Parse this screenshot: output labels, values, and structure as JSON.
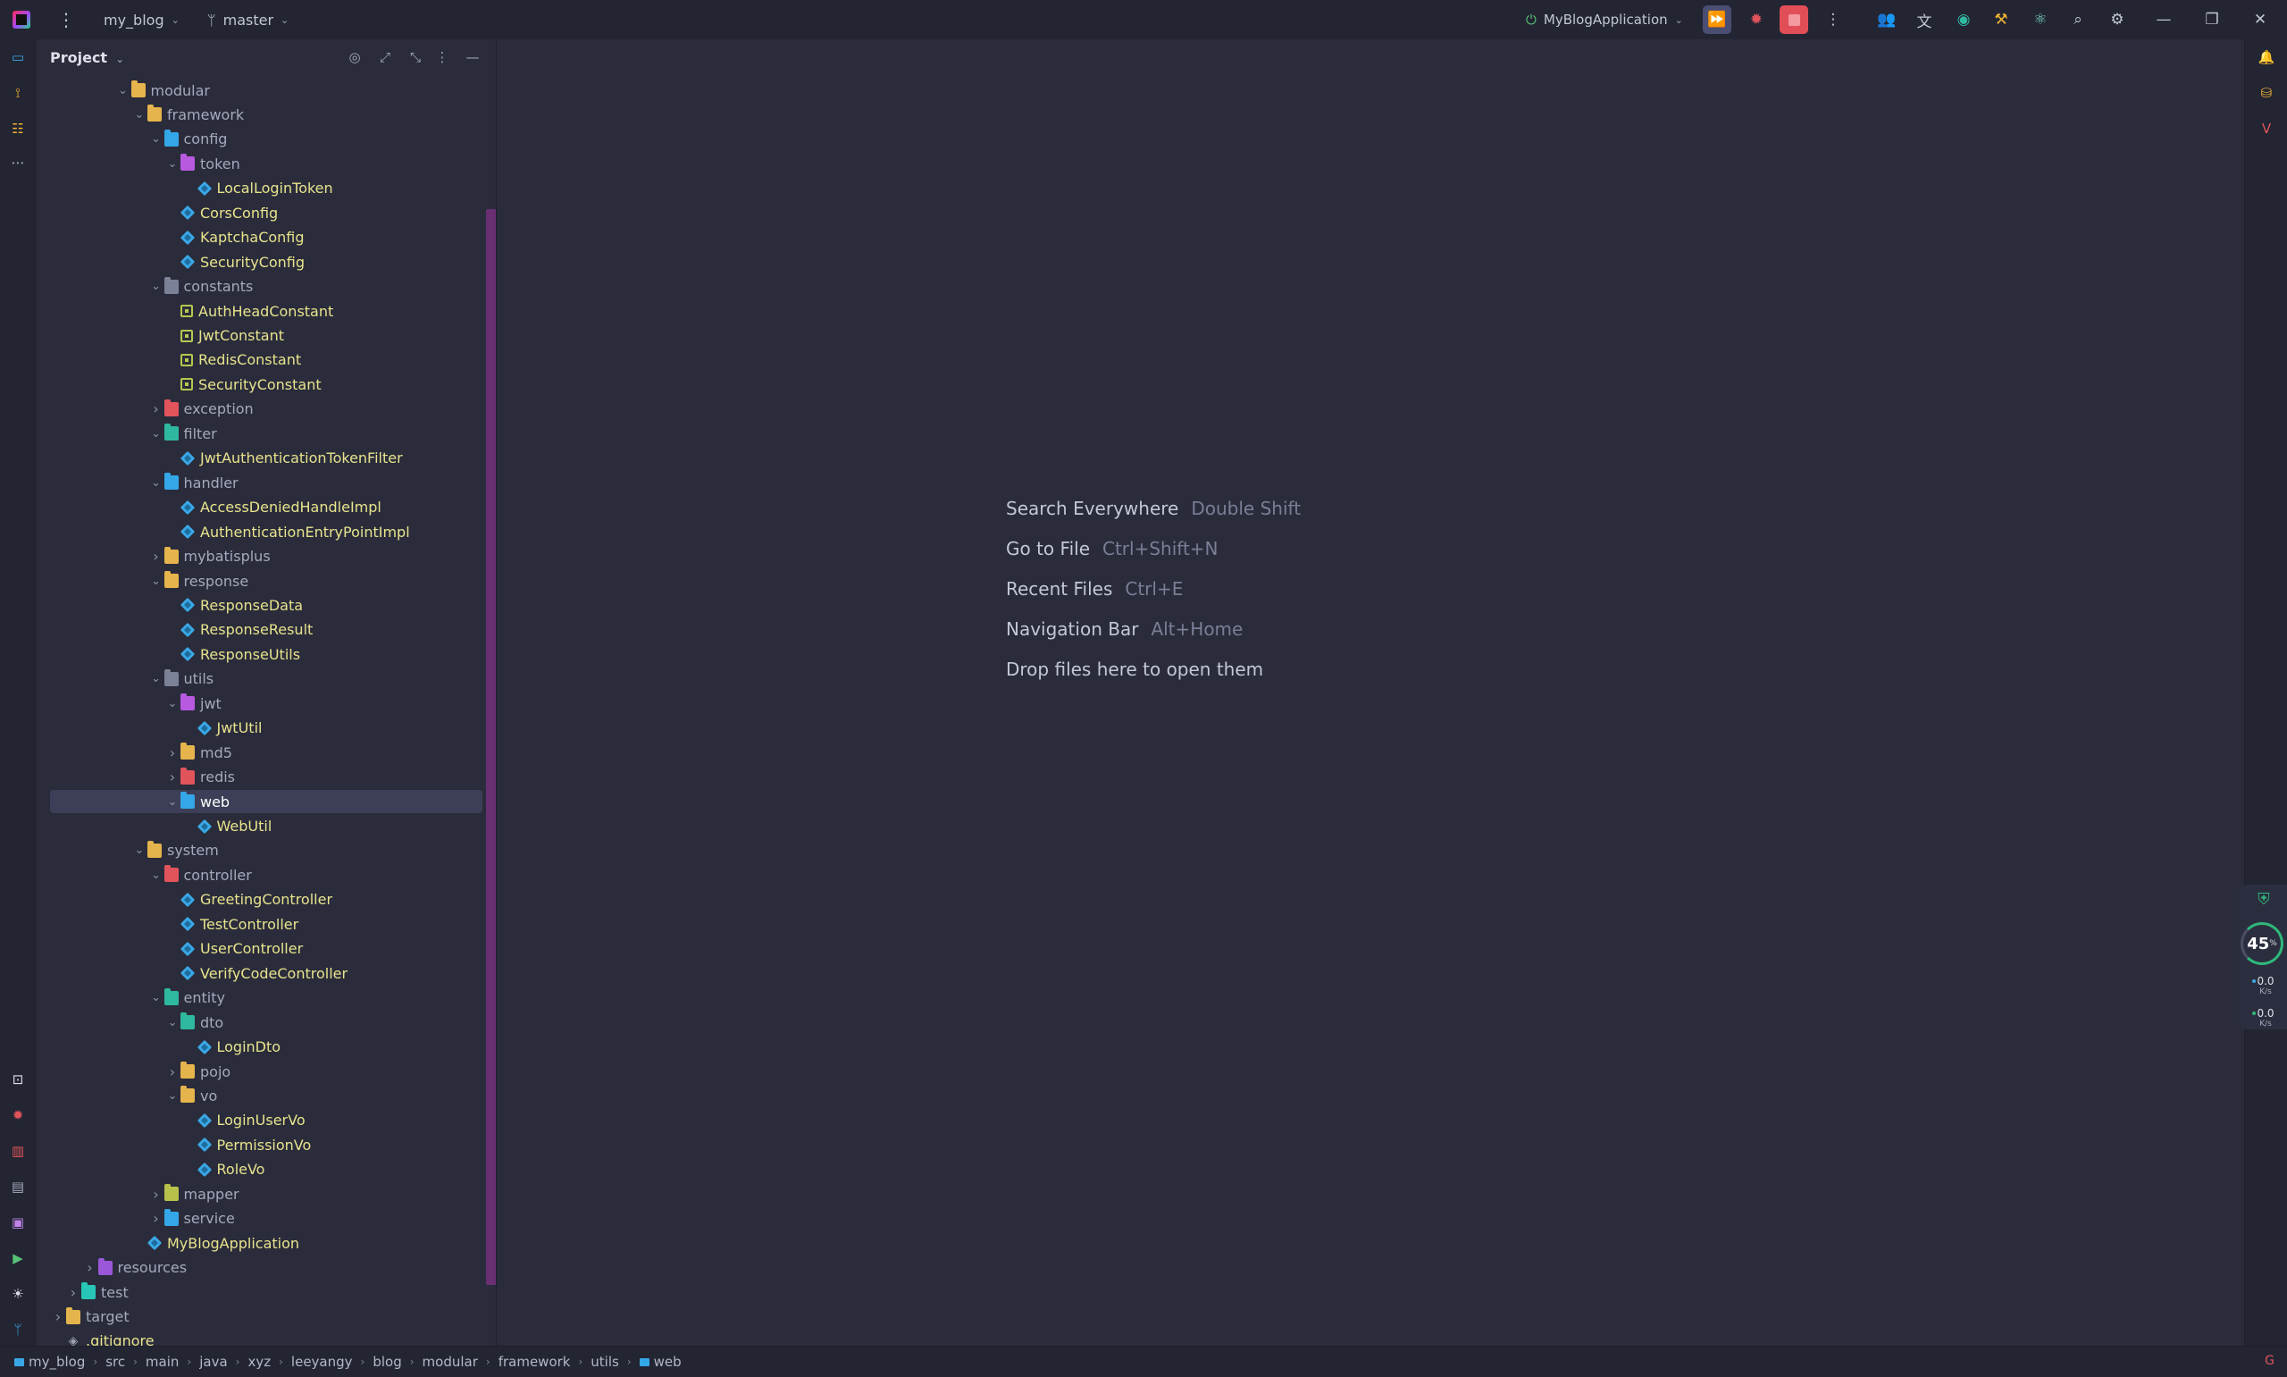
{
  "titlebar": {
    "project": "my_blog",
    "branch": "master",
    "run_config": "MyBlogApplication"
  },
  "panel": {
    "title": "Project"
  },
  "tree": [
    {
      "label": "modular",
      "type": "folder",
      "depth": 5,
      "expanded": true,
      "color": "pkg-default"
    },
    {
      "label": "framework",
      "type": "folder",
      "depth": 6,
      "expanded": true,
      "color": "pkg-default"
    },
    {
      "label": "config",
      "type": "folder",
      "depth": 7,
      "expanded": true,
      "color": "pkg-blue"
    },
    {
      "label": "token",
      "type": "folder",
      "depth": 8,
      "expanded": true,
      "color": "pkg-purple"
    },
    {
      "label": "LocalLoginToken",
      "type": "class",
      "depth": 9
    },
    {
      "label": "CorsConfig",
      "type": "class",
      "depth": 8
    },
    {
      "label": "KaptchaConfig",
      "type": "class",
      "depth": 8
    },
    {
      "label": "SecurityConfig",
      "type": "class",
      "depth": 8
    },
    {
      "label": "constants",
      "type": "folder",
      "depth": 7,
      "expanded": true,
      "color": "pkg-gray"
    },
    {
      "label": "AuthHeadConstant",
      "type": "const",
      "depth": 8
    },
    {
      "label": "JwtConstant",
      "type": "const",
      "depth": 8
    },
    {
      "label": "RedisConstant",
      "type": "const",
      "depth": 8
    },
    {
      "label": "SecurityConstant",
      "type": "const",
      "depth": 8
    },
    {
      "label": "exception",
      "type": "folder",
      "depth": 7,
      "expanded": false,
      "color": "pkg-red"
    },
    {
      "label": "filter",
      "type": "folder",
      "depth": 7,
      "expanded": true,
      "color": "pkg-green"
    },
    {
      "label": "JwtAuthenticationTokenFilter",
      "type": "class",
      "depth": 8
    },
    {
      "label": "handler",
      "type": "folder",
      "depth": 7,
      "expanded": true,
      "color": "pkg-blue"
    },
    {
      "label": "AccessDeniedHandleImpl",
      "type": "class",
      "depth": 8
    },
    {
      "label": "AuthenticationEntryPointImpl",
      "type": "class",
      "depth": 8
    },
    {
      "label": "mybatisplus",
      "type": "folder",
      "depth": 7,
      "expanded": false,
      "color": "pkg-default"
    },
    {
      "label": "response",
      "type": "folder",
      "depth": 7,
      "expanded": true,
      "color": "pkg-default"
    },
    {
      "label": "ResponseData",
      "type": "class",
      "depth": 8
    },
    {
      "label": "ResponseResult",
      "type": "class",
      "depth": 8
    },
    {
      "label": "ResponseUtils",
      "type": "class",
      "depth": 8
    },
    {
      "label": "utils",
      "type": "folder",
      "depth": 7,
      "expanded": true,
      "color": "pkg-gray"
    },
    {
      "label": "jwt",
      "type": "folder",
      "depth": 8,
      "expanded": true,
      "color": "pkg-purple"
    },
    {
      "label": "JwtUtil",
      "type": "class",
      "depth": 9
    },
    {
      "label": "md5",
      "type": "folder",
      "depth": 8,
      "expanded": false,
      "color": "pkg-default"
    },
    {
      "label": "redis",
      "type": "folder",
      "depth": 8,
      "expanded": false,
      "color": "pkg-red"
    },
    {
      "label": "web",
      "type": "folder",
      "depth": 8,
      "expanded": true,
      "color": "pkg-blue",
      "selected": true
    },
    {
      "label": "WebUtil",
      "type": "class",
      "depth": 9
    },
    {
      "label": "system",
      "type": "folder",
      "depth": 6,
      "expanded": true,
      "color": "pkg-default"
    },
    {
      "label": "controller",
      "type": "folder",
      "depth": 7,
      "expanded": true,
      "color": "pkg-red"
    },
    {
      "label": "GreetingController",
      "type": "class",
      "depth": 8
    },
    {
      "label": "TestController",
      "type": "class",
      "depth": 8
    },
    {
      "label": "UserController",
      "type": "class",
      "depth": 8
    },
    {
      "label": "VerifyCodeController",
      "type": "class",
      "depth": 8
    },
    {
      "label": "entity",
      "type": "folder",
      "depth": 7,
      "expanded": true,
      "color": "pkg-green"
    },
    {
      "label": "dto",
      "type": "folder",
      "depth": 8,
      "expanded": true,
      "color": "pkg-green"
    },
    {
      "label": "LoginDto",
      "type": "class",
      "depth": 9
    },
    {
      "label": "pojo",
      "type": "folder",
      "depth": 8,
      "expanded": false,
      "color": "pkg-default"
    },
    {
      "label": "vo",
      "type": "folder",
      "depth": 8,
      "expanded": true,
      "color": "pkg-default"
    },
    {
      "label": "LoginUserVo",
      "type": "class",
      "depth": 9
    },
    {
      "label": "PermissionVo",
      "type": "class",
      "depth": 9
    },
    {
      "label": "RoleVo",
      "type": "class",
      "depth": 9
    },
    {
      "label": "mapper",
      "type": "folder",
      "depth": 7,
      "expanded": false,
      "color": "pkg-lime"
    },
    {
      "label": "service",
      "type": "folder",
      "depth": 7,
      "expanded": false,
      "color": "pkg-blue"
    },
    {
      "label": "MyBlogApplication",
      "type": "main",
      "depth": 6
    },
    {
      "label": "resources",
      "type": "folder",
      "depth": 3,
      "expanded": false,
      "color": "pkg-violet"
    },
    {
      "label": "test",
      "type": "folder",
      "depth": 2,
      "expanded": false,
      "color": "pkg-teal"
    },
    {
      "label": "target",
      "type": "folder",
      "depth": 1,
      "expanded": false,
      "color": "pkg-default"
    },
    {
      "label": ".gitignore",
      "type": "file",
      "depth": 1
    }
  ],
  "editor_hints": [
    {
      "label": "Search Everywhere",
      "key": "Double Shift"
    },
    {
      "label": "Go to File",
      "key": "Ctrl+Shift+N"
    },
    {
      "label": "Recent Files",
      "key": "Ctrl+E"
    },
    {
      "label": "Navigation Bar",
      "key": "Alt+Home"
    },
    {
      "label": "Drop files here to open them",
      "key": ""
    }
  ],
  "perf": {
    "cpu_percent": "45",
    "cpu_unit": "%",
    "upload": "0.0",
    "upload_unit": "K/s",
    "download": "0.0",
    "download_unit": "K/s"
  },
  "breadcrumbs": [
    "my_blog",
    "src",
    "main",
    "java",
    "xyz",
    "leeyangy",
    "blog",
    "modular",
    "framework",
    "utils",
    "web"
  ],
  "colors": {
    "background": "#2a2c3b",
    "chrome": "#232533",
    "selection": "#3c3f57",
    "class_text": "#e8e38d",
    "stop_red": "#e24e57"
  }
}
